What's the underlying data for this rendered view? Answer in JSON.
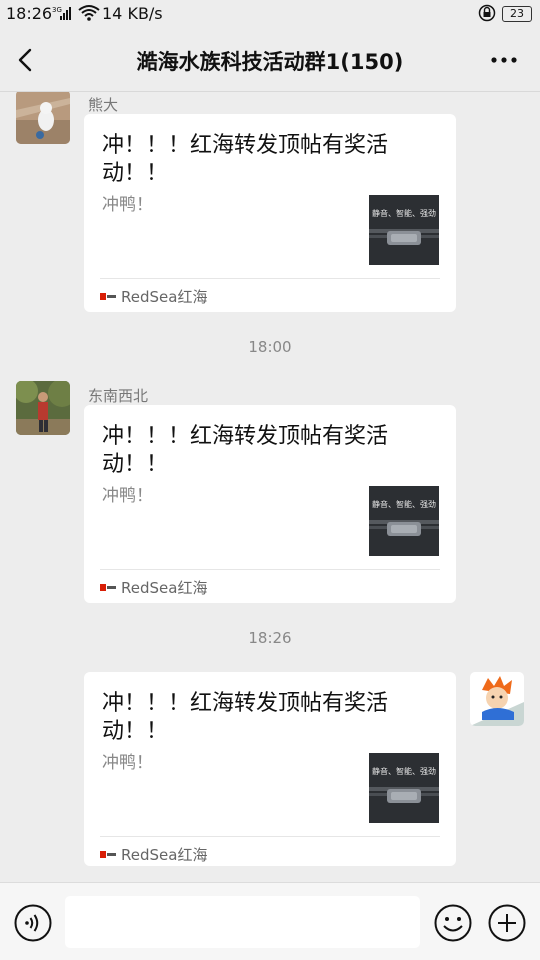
{
  "status_bar": {
    "time": "18:26",
    "net_label": "3G",
    "speed": "14 KB/s",
    "battery": "23"
  },
  "nav": {
    "title": "澔海水族科技活动群1(150)"
  },
  "messages": [
    {
      "sender": "熊大",
      "card": {
        "title": "冲！！！红海转发顶帖有奖活动！！",
        "desc": "冲鸭！",
        "thumb_text": "静音、智能、强劲",
        "source": "RedSea红海"
      }
    },
    {
      "sender": "东南西北",
      "card": {
        "title": "冲！！！红海转发顶帖有奖活动！！",
        "desc": "冲鸭！",
        "thumb_text": "静音、智能、强劲",
        "source": "RedSea红海"
      }
    },
    {
      "sender": "",
      "card": {
        "title": "冲！！！红海转发顶帖有奖活动！！",
        "desc": "冲鸭！",
        "thumb_text": "静音、智能、强劲",
        "source": "RedSea红海"
      }
    }
  ],
  "timestamps": [
    "18:00",
    "18:26"
  ],
  "input": {
    "placeholder": ""
  },
  "colors": {
    "background": "#ededed",
    "card": "#ffffff",
    "brand_red": "#d81e06"
  },
  "icons": [
    "back-arrow-icon",
    "more-dots-icon",
    "voice-icon",
    "emoji-icon",
    "plus-icon",
    "wifi-icon",
    "signal-icon",
    "lock-icon",
    "battery-icon"
  ]
}
